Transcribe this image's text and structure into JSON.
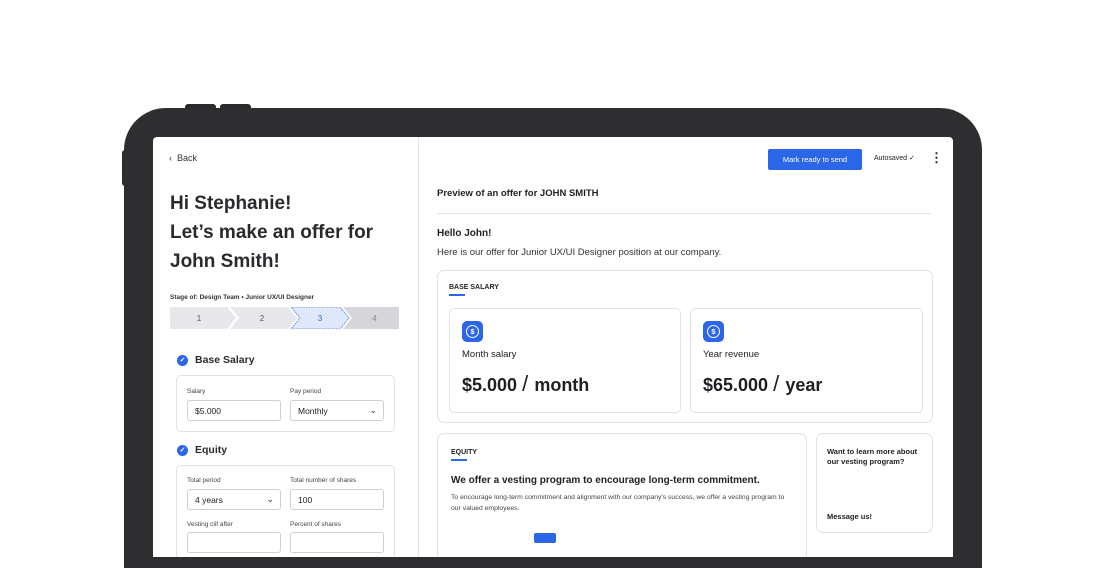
{
  "left": {
    "back_label": "Back",
    "greeting_line1": "Hi Stephanie!",
    "greeting_line2": "Let’s make an offer for",
    "greeting_line3": "John Smith!",
    "stage_label": "Stage of: Design Team • Junior UX/UI Designer",
    "steps": [
      "1",
      "2",
      "3",
      "4"
    ],
    "active_step": 3,
    "base_salary": {
      "title": "Base Salary",
      "salary_label": "Salary",
      "salary_value": "$5.000",
      "pay_period_label": "Pay period",
      "pay_period_value": "Monthly"
    },
    "equity": {
      "title": "Equity",
      "total_period_label": "Total period",
      "total_period_value": "4 years",
      "total_shares_label": "Total number of shares",
      "total_shares_value": "100",
      "vesting_cliff_label": "Vesting clif after",
      "percent_shares_label": "Percent of shares"
    }
  },
  "right": {
    "mark_ready_label": "Mark ready to send",
    "autosaved_label": "Autosaved ✓",
    "preview_title": "Preview of an offer for JOHN SMITH",
    "hello": "Hello John!",
    "intro": "Here is our offer for Junior UX/UI Designer position at our company.",
    "base_salary": {
      "title": "BASE SALARY",
      "month_label": "Month salary",
      "month_value": "$5.000",
      "month_unit": "month",
      "year_label": "Year revenue",
      "year_value": "$65.000",
      "year_unit": "year"
    },
    "equity": {
      "title": "EQUITY",
      "headline": "We offer a vesting program to encourage long-term commitment.",
      "body": "To encourage long-term commitment and alignment with our company's success, we offer a vesting program to our valued employees."
    },
    "learn_more": {
      "text": "Want to learn more about our vesting program?",
      "link": "Message us!"
    }
  },
  "colors": {
    "accent": "#2c66e8",
    "device": "#2e2e30"
  }
}
